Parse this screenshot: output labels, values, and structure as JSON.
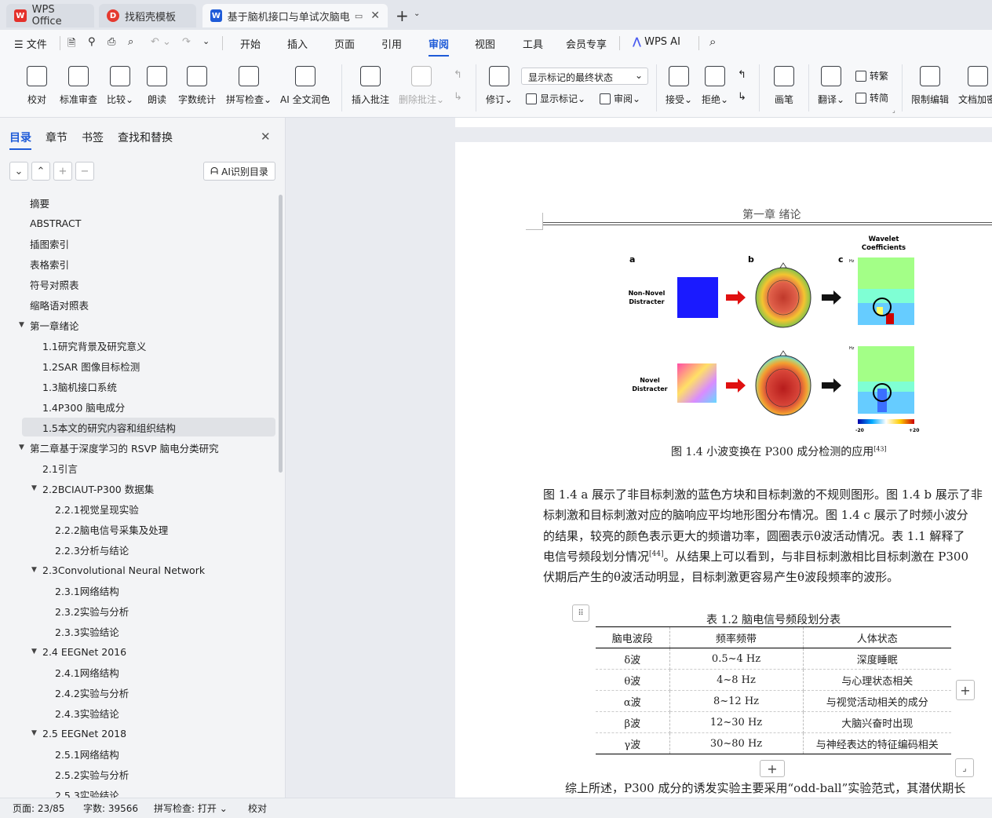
{
  "tabs": [
    {
      "label": "WPS Office",
      "icon": "wps-logo-icon"
    },
    {
      "label": "找稻壳模板",
      "icon": "docer-icon"
    },
    {
      "label": "基于脑机接口与单试次脑电分",
      "icon": "word-doc-icon"
    }
  ],
  "menu": {
    "file": "文件",
    "items": [
      "开始",
      "插入",
      "页面",
      "引用",
      "审阅",
      "视图",
      "工具",
      "会员专享"
    ],
    "selected": "审阅",
    "ai": "WPS AI"
  },
  "ribbon": {
    "proofread": "校对",
    "standard_review": "标准审查",
    "compare": "比较",
    "read_aloud": "朗读",
    "word_count": "字数统计",
    "spell_check": "拼写检查",
    "ai_polish": "AI 全文润色",
    "insert_comment": "插入批注",
    "delete_comment": "删除批注",
    "track_changes": "修订",
    "markup_view": "显示标记的最终状态",
    "show_markup": "显示标记",
    "review": "审阅",
    "accept": "接受",
    "reject": "拒绝",
    "pen": "画笔",
    "translate": "翻译",
    "to_traditional": "转繁",
    "to_simplified": "转简",
    "restrict_edit": "限制编辑",
    "doc_encrypt": "文档加密"
  },
  "sidebar": {
    "tabs": [
      "目录",
      "章节",
      "书签",
      "查找和替换"
    ],
    "selected_tab": "目录",
    "ai_toc": "AI识别目录",
    "toc": [
      {
        "label": "摘要",
        "level": 1
      },
      {
        "label": "ABSTRACT",
        "level": 1
      },
      {
        "label": "插图索引",
        "level": 1
      },
      {
        "label": "表格索引",
        "level": 1
      },
      {
        "label": "符号对照表",
        "level": 1
      },
      {
        "label": "缩略语对照表",
        "level": 1
      },
      {
        "label": "第一章绪论",
        "level": 1,
        "expanded": true
      },
      {
        "label": "1.1研究背景及研究意义",
        "level": 2
      },
      {
        "label": "1.2SAR 图像目标检测",
        "level": 2
      },
      {
        "label": "1.3脑机接口系统",
        "level": 2
      },
      {
        "label": "1.4P300 脑电成分",
        "level": 2
      },
      {
        "label": "1.5本文的研究内容和组织结构",
        "level": 2,
        "selected": true
      },
      {
        "label": "第二章基于深度学习的 RSVP 脑电分类研究",
        "level": 1,
        "expanded": true
      },
      {
        "label": "2.1引言",
        "level": 2
      },
      {
        "label": "2.2BCIAUT-P300 数据集",
        "level": 2,
        "expanded": true
      },
      {
        "label": "2.2.1视觉呈现实验",
        "level": 3
      },
      {
        "label": "2.2.2脑电信号采集及处理",
        "level": 3
      },
      {
        "label": "2.2.3分析与结论",
        "level": 3
      },
      {
        "label": "2.3Convolutional Neural Network",
        "level": 2,
        "expanded": true
      },
      {
        "label": "2.3.1网络结构",
        "level": 3
      },
      {
        "label": "2.3.2实验与分析",
        "level": 3
      },
      {
        "label": "2.3.3实验结论",
        "level": 3
      },
      {
        "label": "2.4  EEGNet 2016",
        "level": 2,
        "expanded": true
      },
      {
        "label": "2.4.1网络结构",
        "level": 3
      },
      {
        "label": "2.4.2实验与分析",
        "level": 3
      },
      {
        "label": "2.4.3实验结论",
        "level": 3
      },
      {
        "label": "2.5  EEGNet 2018",
        "level": 2,
        "expanded": true
      },
      {
        "label": "2.5.1网络结构",
        "level": 3
      },
      {
        "label": "2.5.2实验与分析",
        "level": 3
      },
      {
        "label": "2.5.3实验结论",
        "level": 3
      }
    ]
  },
  "document": {
    "header": "第一章  绪论",
    "figure": {
      "label_a": "a",
      "label_b": "b",
      "label_c": "c",
      "wavelet_title_1": "Wavelet",
      "wavelet_title_2": "Coefficients",
      "row1_label_1": "Non-Novel",
      "row1_label_2": "Distracter",
      "row2_label_1": "Novel",
      "row2_label_2": "Distracter",
      "colorbar_min": "-20",
      "colorbar_max": "+20",
      "hz": "Hz",
      "caption": "图 1.4  小波变换在 P300 成分检测的应用",
      "caption_ref": "[43]",
      "colors": {
        "blue_square": "#1a1aff",
        "arrow_red": "#e01010"
      }
    },
    "paragraph_lines": [
      "图 1.4 a 展示了非目标刺激的蓝色方块和目标刺激的不规则图形。图 1.4 b 展示了非",
      "标刺激和目标刺激对应的脑响应平均地形图分布情况。图 1.4 c 展示了时频小波分",
      "的结果，较亮的颜色表示更大的频谱功率，圆圈表示θ波活动情况。表 1.1 解释了",
      "电信号频段划分情况",
      "伏期后产生的θ波活动明显，目标刺激更容易产生θ波段频率的波形。"
    ],
    "line4_ref": "[44]",
    "line4_rest": "。从结果上可以看到，与非目标刺激相比目标刺激在 P300",
    "table_title": "表 1.2  脑电信号频段划分表",
    "table_headers": [
      "脑电波段",
      "频率频带",
      "人体状态"
    ],
    "table_rows": [
      [
        "δ波",
        "0.5~4 Hz",
        "深度睡眠"
      ],
      [
        "θ波",
        "4~8 Hz",
        "与心理状态相关"
      ],
      [
        "α波",
        "8~12 Hz",
        "与视觉活动相关的成分"
      ],
      [
        "β波",
        "12~30 Hz",
        "大脑兴奋时出现"
      ],
      [
        "γ波",
        "30~80 Hz",
        "与神经表达的特征编码相关"
      ]
    ],
    "last_line": "综上所述，P300 成分的诱发实验主要采用“odd-ball”实验范式，其潜伏期长"
  },
  "status": {
    "page": "页面: 23/85",
    "words": "字数: 39566",
    "spell": "拼写检查: 打开",
    "proof": "校对"
  }
}
